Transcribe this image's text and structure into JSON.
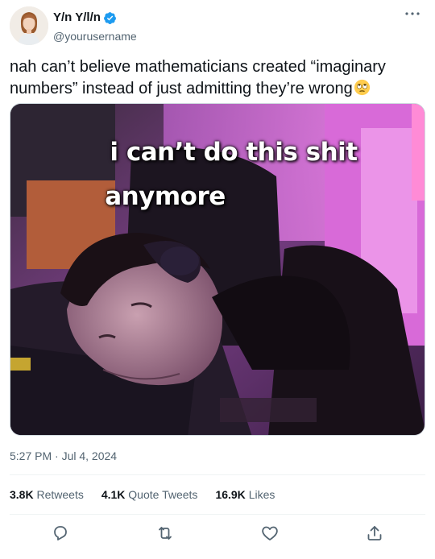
{
  "author": {
    "display_name": "Y/n Y/l/n",
    "handle": "@yourusername",
    "avatar_icon": "avatar-portrait",
    "verified_icon": "verified-badge-icon",
    "verified_color": "#1d9bf0"
  },
  "tweet": {
    "text": "nah can’t believe mathematicians created “imaginary numbers” instead of just admitting they’re wrong",
    "emoji_icon": "face-with-rolling-eyes-emoji",
    "timestamp": "5:27 PM · Jul 4, 2024"
  },
  "media": {
    "caption_line1": "i can’t do this shit",
    "caption_line2": "anymore",
    "description_icon": "meme-photo"
  },
  "stats": {
    "retweets_count": "3.8K",
    "retweets_label": "Retweets",
    "quotes_count": "4.1K",
    "quotes_label": "Quote Tweets",
    "likes_count": "16.9K",
    "likes_label": "Likes"
  },
  "actions": {
    "reply_icon": "reply-icon",
    "retweet_icon": "retweet-icon",
    "like_icon": "heart-icon",
    "share_icon": "share-icon",
    "icon_color": "#536471"
  }
}
